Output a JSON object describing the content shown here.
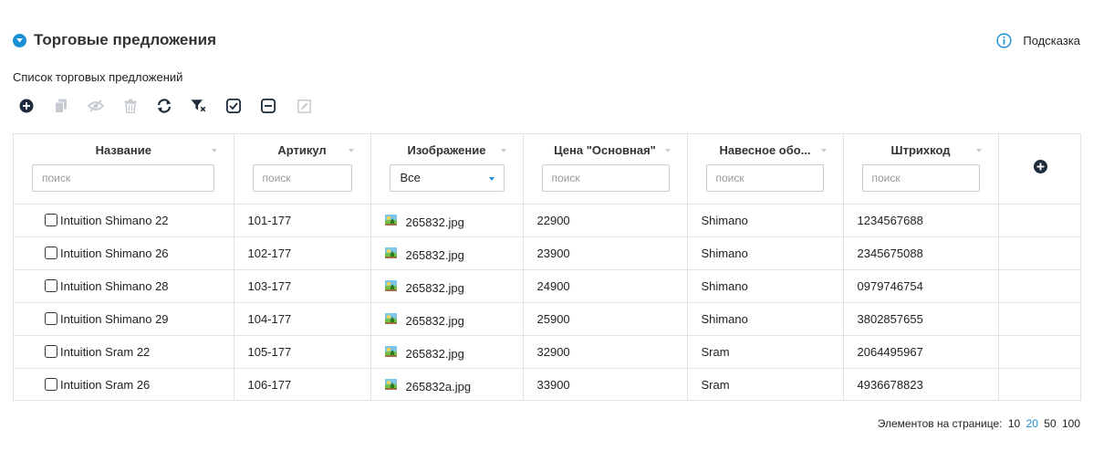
{
  "header": {
    "title": "Торговые предложения"
  },
  "hint": {
    "label": "Подсказка"
  },
  "section": {
    "subtitle": "Список торговых предложений"
  },
  "toolbar": {
    "buttons": [
      {
        "icon": "add-circle-icon",
        "enabled": true
      },
      {
        "icon": "copy-icon",
        "enabled": false
      },
      {
        "icon": "hide-icon",
        "enabled": false
      },
      {
        "icon": "trash-icon",
        "enabled": false
      },
      {
        "icon": "refresh-icon",
        "enabled": true
      },
      {
        "icon": "clear-filter-icon",
        "enabled": true
      },
      {
        "icon": "select-all-icon",
        "enabled": true
      },
      {
        "icon": "deselect-icon",
        "enabled": true
      },
      {
        "icon": "edit-icon",
        "enabled": false
      }
    ]
  },
  "table": {
    "columns": [
      {
        "title": "Название",
        "filter_placeholder": "поиск"
      },
      {
        "title": "Артикул",
        "filter_placeholder": "поиск"
      },
      {
        "title": "Изображение",
        "filter_value": "Все"
      },
      {
        "title": "Цена \"Основная\"",
        "filter_placeholder": "поиск"
      },
      {
        "title": "Навесное обо...",
        "filter_placeholder": "поиск"
      },
      {
        "title": "Штрихкод",
        "filter_placeholder": "поиск"
      }
    ],
    "rows": [
      {
        "name": "Intuition Shimano 22",
        "sku": "101-177",
        "image": "265832.jpg",
        "price": "22900",
        "equipment": "Shimano",
        "barcode": "1234567688"
      },
      {
        "name": "Intuition Shimano 26",
        "sku": "102-177",
        "image": "265832.jpg",
        "price": "23900",
        "equipment": "Shimano",
        "barcode": "2345675088"
      },
      {
        "name": "Intuition Shimano 28",
        "sku": "103-177",
        "image": "265832.jpg",
        "price": "24900",
        "equipment": "Shimano",
        "barcode": "0979746754"
      },
      {
        "name": "Intuition Shimano 29",
        "sku": "104-177",
        "image": "265832.jpg",
        "price": "25900",
        "equipment": "Shimano",
        "barcode": "3802857655"
      },
      {
        "name": "Intuition Sram 22",
        "sku": "105-177",
        "image": "265832.jpg",
        "price": "32900",
        "equipment": "Sram",
        "barcode": "2064495967"
      },
      {
        "name": "Intuition Sram 26",
        "sku": "106-177",
        "image": "265832a.jpg",
        "price": "33900",
        "equipment": "Sram",
        "barcode": "4936678823"
      }
    ]
  },
  "footer": {
    "label": "Элементов на странице:",
    "page_sizes": [
      "10",
      "20",
      "50",
      "100"
    ],
    "active_page_size": "20"
  },
  "colors": {
    "accent": "#1a8fd6",
    "dark_icon": "#1b2b3a",
    "disabled_icon": "#c5cbd0",
    "border": "#e2e2e2"
  }
}
